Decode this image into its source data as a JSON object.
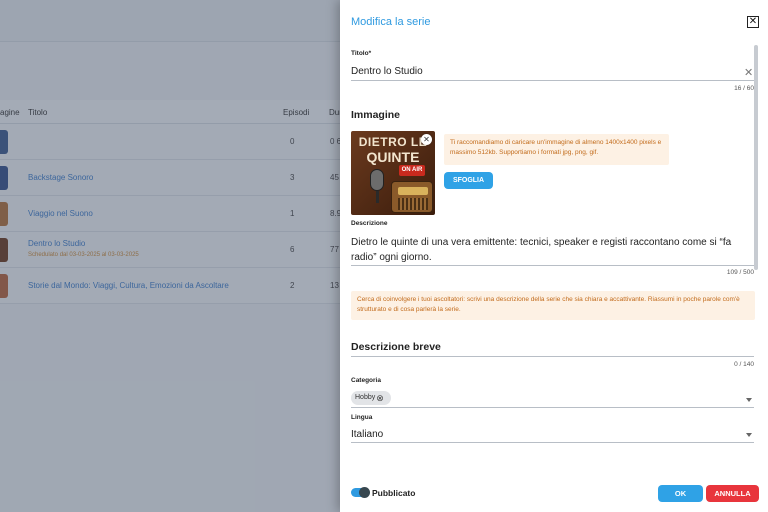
{
  "background": {
    "columns": {
      "image": "agine",
      "title": "Titolo",
      "episodes": "Episodi",
      "duration": "Dur"
    },
    "rows": [
      {
        "title": "",
        "subtitle": "",
        "episodes": "0",
        "duration": "0 6",
        "thumb_color": "#3b5b8e"
      },
      {
        "title": "Backstage Sonoro",
        "subtitle": "",
        "episodes": "3",
        "duration": "45",
        "thumb_color": "#34508a"
      },
      {
        "title": "Viaggio nel Suono",
        "subtitle": "",
        "episodes": "1",
        "duration": "8.9",
        "thumb_color": "#b0703a"
      },
      {
        "title": "Dentro lo Studio",
        "subtitle": "Schedulato dal 03-03-2025 al 03-03-2025",
        "episodes": "6",
        "duration": "77",
        "thumb_color": "#6b3a1e"
      },
      {
        "title": "Storie dal Mondo: Viaggi, Cultura, Emozioni da Ascoltare",
        "subtitle": "",
        "episodes": "2",
        "duration": "13",
        "thumb_color": "#b5623b"
      }
    ]
  },
  "dialog": {
    "title": "Modifica la serie",
    "title_field": {
      "label": "Titolo*",
      "value": "Dentro lo Studio",
      "counter": "16 / 60"
    },
    "image_section": {
      "heading": "Immagine",
      "cover_text_line1": "DIETRO LE",
      "cover_text_line2": "QUINTE",
      "cover_badge": "ON AIR",
      "note": "Ti raccomandiamo di caricare un'immagine di almeno 1400x1400 pixels e massimo 512kb. Supportiamo i formati jpg, png, gif.",
      "browse_label": "SFOGLIA"
    },
    "description": {
      "label": "Descrizione",
      "value": "Dietro le quinte di una vera emittente: tecnici, speaker e registi raccontano come si “fa radio” ogni giorno.",
      "counter": "109 / 500",
      "note": "Cerca di coinvolgere i tuoi ascoltatori: scrivi una descrizione della serie che sia chiara e accattivante. Riassumi in poche parole com'è strutturato e di cosa parlerà la serie."
    },
    "short_description": {
      "heading": "Descrizione breve",
      "counter": "0 / 140"
    },
    "category": {
      "label": "Categoria",
      "chip": "Hobby"
    },
    "language": {
      "label": "Lingua",
      "value": "Italiano"
    },
    "published": {
      "label": "Pubblicato",
      "on": true
    },
    "ok_label": "OK",
    "cancel_label": "ANNULLA"
  },
  "colors": {
    "accent": "#2fa2e6",
    "danger": "#e8353c",
    "warning_bg": "#fdf1e4",
    "warning_text": "#c26b1b"
  }
}
